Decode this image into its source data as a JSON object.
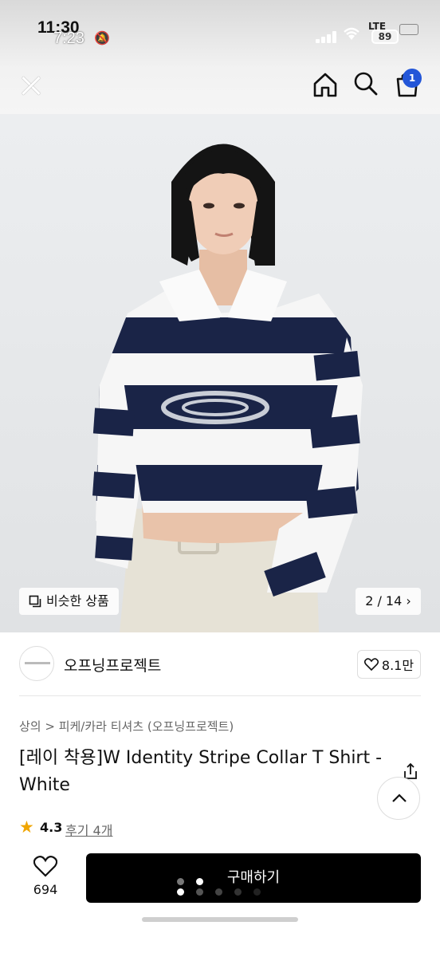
{
  "status_bar": {
    "time_primary": "11:30",
    "time_overlay": "7:23",
    "network": "LTE",
    "battery": "89"
  },
  "header": {
    "close_icon": "close-icon",
    "home_icon": "home-icon",
    "search_icon": "search-icon",
    "cart_icon": "cart-icon",
    "cart_badge": "1"
  },
  "gallery": {
    "similar_label": "비슷한 상품",
    "page_indicator": "2 / 14",
    "page_chevron": "›"
  },
  "brand": {
    "name": "오프닝프로젝트",
    "likes": "8.1만"
  },
  "product": {
    "breadcrumb": "상의 > 피케/카라 티셔츠 (오프닝프로젝트)",
    "title": "[레이 착용]W Identity Stripe Collar T Shirt - White",
    "rating": "4.3",
    "reviews": "후기 4개"
  },
  "bottom_bar": {
    "wish_count": "694",
    "buy_label": "구매하기"
  },
  "colors": {
    "accent_blue": "#2356d8",
    "navy": "#1a2447",
    "star": "#f0a500"
  }
}
